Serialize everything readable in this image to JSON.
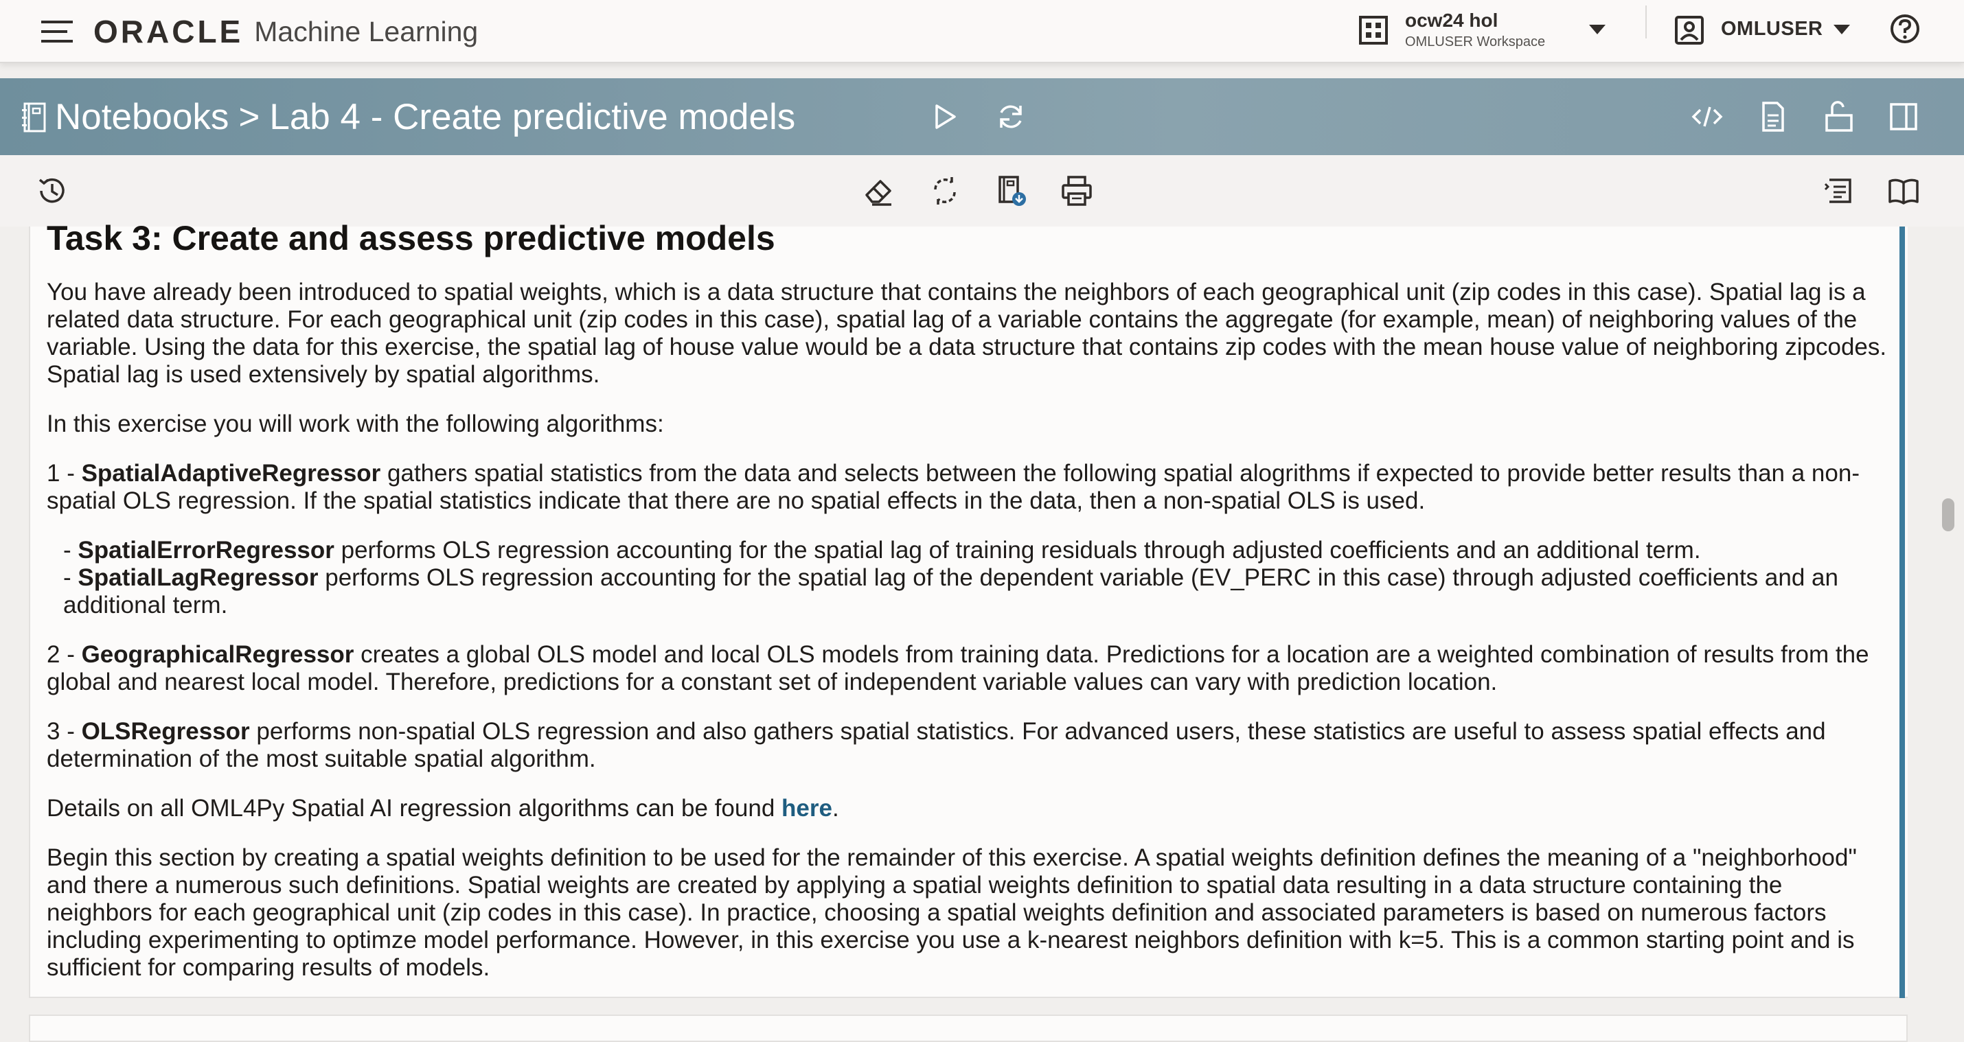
{
  "app": {
    "brand_oracle": "ORACLE",
    "brand_product": "Machine Learning"
  },
  "workspace": {
    "name": "ocw24 hol",
    "subtitle": "OMLUSER Workspace"
  },
  "user": {
    "name": "OMLUSER"
  },
  "breadcrumb": {
    "root": "Notebooks",
    "separator": ">",
    "current": "Lab 4 - Create predictive models"
  },
  "content": {
    "heading": "Task 3: Create and assess predictive models",
    "intro": "You have already been introduced to spatial weights, which is a data structure that contains the neighbors of each geographical unit (zip codes in this case). Spatial lag is a related data structure. For each geographical unit (zip codes in this case), spatial lag of a variable contains the aggregate (for example, mean) of neighboring values of the variable. Using the data for this exercise, the spatial lag of house value would be a data structure that contains zip codes with the mean house value of neighboring zipcodes. Spatial lag is used extensively by spatial algorithms.",
    "algorithms_intro": "In this exercise you will work with the following algorithms:",
    "algo1_prefix": "1 - ",
    "algo1_name": "SpatialAdaptiveRegressor",
    "algo1_text": " gathers spatial statistics from the data and selects between the following spatial alogrithms if expected to provide better results than a non-spatial OLS regression. If the spatial statistics indicate that there are no spatial effects in the data, then a non-spatial OLS is used.",
    "sub1_prefix": "- ",
    "sub1_name": "SpatialErrorRegressor",
    "sub1_text": " performs OLS regression accounting for the spatial lag of training residuals through adjusted coefficients and an additional term.",
    "sub2_prefix": "- ",
    "sub2_name": "SpatialLagRegressor",
    "sub2_text": " performs OLS regression accounting for the spatial lag of the dependent variable (EV_PERC in this case) through adjusted coefficients and an additional term.",
    "algo2_prefix": "2 - ",
    "algo2_name": "GeographicalRegressor",
    "algo2_text": " creates a global OLS model and local OLS models from training data. Predictions for a location are a weighted combination of results from the global and nearest local model. Therefore, predictions for a constant set of independent variable values can vary with prediction location.",
    "algo3_prefix": "3 - ",
    "algo3_name": "OLSRegressor",
    "algo3_text": " performs non-spatial OLS regression and also gathers spatial statistics. For advanced users, these statistics are useful to assess spatial effects and determination of the most suitable spatial algorithm.",
    "details_text": "Details on all OML4Py Spatial AI regression algorithms can be found ",
    "details_link": "here",
    "details_end": ".",
    "begin": "Begin this section by creating a spatial weights definition to be used for the remainder of this exercise. A spatial weights definition defines the meaning of a \"neighborhood\" and there a numerous such definitions. Spatial weights are created by applying a spatial weights definition to spatial data resulting in a data structure containing the neighbors for each geographical unit (zip codes in this case). In practice, choosing a spatial weights definition and associated parameters is based on numerous factors including experimenting to optimze model performance. However, in this exercise you use a k-nearest neighbors definition with k=5. This is a common starting point and is sufficient for comparing results of models."
  },
  "colors": {
    "notebook_bar": "#7c98a5",
    "paragraph_accent": "#3c7b9c",
    "link": "#1f5d80"
  },
  "icons": {
    "menu": "hamburger-icon",
    "workspace": "grid-icon",
    "user": "user-icon",
    "help": "help-icon",
    "run": "play-icon",
    "refresh": "refresh-icon",
    "code": "code-icon",
    "document": "document-icon",
    "unlock": "unlock-icon",
    "panel": "panel-icon",
    "versions": "history-icon",
    "clear": "eraser-icon",
    "invalidate": "invalidate-icon",
    "export": "export-icon",
    "print": "print-icon",
    "list": "list-icon",
    "book": "book-icon"
  }
}
